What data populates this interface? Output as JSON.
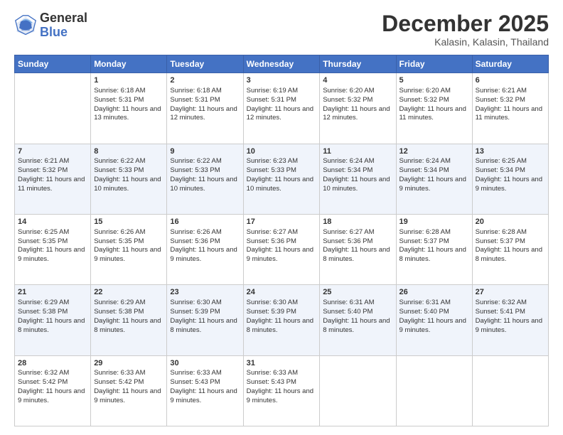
{
  "header": {
    "logo_general": "General",
    "logo_blue": "Blue",
    "month_title": "December 2025",
    "location": "Kalasin, Kalasin, Thailand"
  },
  "days_of_week": [
    "Sunday",
    "Monday",
    "Tuesday",
    "Wednesday",
    "Thursday",
    "Friday",
    "Saturday"
  ],
  "weeks": [
    [
      {
        "day": "",
        "sunrise": "",
        "sunset": "",
        "daylight": ""
      },
      {
        "day": "1",
        "sunrise": "Sunrise: 6:18 AM",
        "sunset": "Sunset: 5:31 PM",
        "daylight": "Daylight: 11 hours and 13 minutes."
      },
      {
        "day": "2",
        "sunrise": "Sunrise: 6:18 AM",
        "sunset": "Sunset: 5:31 PM",
        "daylight": "Daylight: 11 hours and 12 minutes."
      },
      {
        "day": "3",
        "sunrise": "Sunrise: 6:19 AM",
        "sunset": "Sunset: 5:31 PM",
        "daylight": "Daylight: 11 hours and 12 minutes."
      },
      {
        "day": "4",
        "sunrise": "Sunrise: 6:20 AM",
        "sunset": "Sunset: 5:32 PM",
        "daylight": "Daylight: 11 hours and 12 minutes."
      },
      {
        "day": "5",
        "sunrise": "Sunrise: 6:20 AM",
        "sunset": "Sunset: 5:32 PM",
        "daylight": "Daylight: 11 hours and 11 minutes."
      },
      {
        "day": "6",
        "sunrise": "Sunrise: 6:21 AM",
        "sunset": "Sunset: 5:32 PM",
        "daylight": "Daylight: 11 hours and 11 minutes."
      }
    ],
    [
      {
        "day": "7",
        "sunrise": "Sunrise: 6:21 AM",
        "sunset": "Sunset: 5:32 PM",
        "daylight": "Daylight: 11 hours and 11 minutes."
      },
      {
        "day": "8",
        "sunrise": "Sunrise: 6:22 AM",
        "sunset": "Sunset: 5:33 PM",
        "daylight": "Daylight: 11 hours and 10 minutes."
      },
      {
        "day": "9",
        "sunrise": "Sunrise: 6:22 AM",
        "sunset": "Sunset: 5:33 PM",
        "daylight": "Daylight: 11 hours and 10 minutes."
      },
      {
        "day": "10",
        "sunrise": "Sunrise: 6:23 AM",
        "sunset": "Sunset: 5:33 PM",
        "daylight": "Daylight: 11 hours and 10 minutes."
      },
      {
        "day": "11",
        "sunrise": "Sunrise: 6:24 AM",
        "sunset": "Sunset: 5:34 PM",
        "daylight": "Daylight: 11 hours and 10 minutes."
      },
      {
        "day": "12",
        "sunrise": "Sunrise: 6:24 AM",
        "sunset": "Sunset: 5:34 PM",
        "daylight": "Daylight: 11 hours and 9 minutes."
      },
      {
        "day": "13",
        "sunrise": "Sunrise: 6:25 AM",
        "sunset": "Sunset: 5:34 PM",
        "daylight": "Daylight: 11 hours and 9 minutes."
      }
    ],
    [
      {
        "day": "14",
        "sunrise": "Sunrise: 6:25 AM",
        "sunset": "Sunset: 5:35 PM",
        "daylight": "Daylight: 11 hours and 9 minutes."
      },
      {
        "day": "15",
        "sunrise": "Sunrise: 6:26 AM",
        "sunset": "Sunset: 5:35 PM",
        "daylight": "Daylight: 11 hours and 9 minutes."
      },
      {
        "day": "16",
        "sunrise": "Sunrise: 6:26 AM",
        "sunset": "Sunset: 5:36 PM",
        "daylight": "Daylight: 11 hours and 9 minutes."
      },
      {
        "day": "17",
        "sunrise": "Sunrise: 6:27 AM",
        "sunset": "Sunset: 5:36 PM",
        "daylight": "Daylight: 11 hours and 9 minutes."
      },
      {
        "day": "18",
        "sunrise": "Sunrise: 6:27 AM",
        "sunset": "Sunset: 5:36 PM",
        "daylight": "Daylight: 11 hours and 8 minutes."
      },
      {
        "day": "19",
        "sunrise": "Sunrise: 6:28 AM",
        "sunset": "Sunset: 5:37 PM",
        "daylight": "Daylight: 11 hours and 8 minutes."
      },
      {
        "day": "20",
        "sunrise": "Sunrise: 6:28 AM",
        "sunset": "Sunset: 5:37 PM",
        "daylight": "Daylight: 11 hours and 8 minutes."
      }
    ],
    [
      {
        "day": "21",
        "sunrise": "Sunrise: 6:29 AM",
        "sunset": "Sunset: 5:38 PM",
        "daylight": "Daylight: 11 hours and 8 minutes."
      },
      {
        "day": "22",
        "sunrise": "Sunrise: 6:29 AM",
        "sunset": "Sunset: 5:38 PM",
        "daylight": "Daylight: 11 hours and 8 minutes."
      },
      {
        "day": "23",
        "sunrise": "Sunrise: 6:30 AM",
        "sunset": "Sunset: 5:39 PM",
        "daylight": "Daylight: 11 hours and 8 minutes."
      },
      {
        "day": "24",
        "sunrise": "Sunrise: 6:30 AM",
        "sunset": "Sunset: 5:39 PM",
        "daylight": "Daylight: 11 hours and 8 minutes."
      },
      {
        "day": "25",
        "sunrise": "Sunrise: 6:31 AM",
        "sunset": "Sunset: 5:40 PM",
        "daylight": "Daylight: 11 hours and 8 minutes."
      },
      {
        "day": "26",
        "sunrise": "Sunrise: 6:31 AM",
        "sunset": "Sunset: 5:40 PM",
        "daylight": "Daylight: 11 hours and 9 minutes."
      },
      {
        "day": "27",
        "sunrise": "Sunrise: 6:32 AM",
        "sunset": "Sunset: 5:41 PM",
        "daylight": "Daylight: 11 hours and 9 minutes."
      }
    ],
    [
      {
        "day": "28",
        "sunrise": "Sunrise: 6:32 AM",
        "sunset": "Sunset: 5:42 PM",
        "daylight": "Daylight: 11 hours and 9 minutes."
      },
      {
        "day": "29",
        "sunrise": "Sunrise: 6:33 AM",
        "sunset": "Sunset: 5:42 PM",
        "daylight": "Daylight: 11 hours and 9 minutes."
      },
      {
        "day": "30",
        "sunrise": "Sunrise: 6:33 AM",
        "sunset": "Sunset: 5:43 PM",
        "daylight": "Daylight: 11 hours and 9 minutes."
      },
      {
        "day": "31",
        "sunrise": "Sunrise: 6:33 AM",
        "sunset": "Sunset: 5:43 PM",
        "daylight": "Daylight: 11 hours and 9 minutes."
      },
      {
        "day": "",
        "sunrise": "",
        "sunset": "",
        "daylight": ""
      },
      {
        "day": "",
        "sunrise": "",
        "sunset": "",
        "daylight": ""
      },
      {
        "day": "",
        "sunrise": "",
        "sunset": "",
        "daylight": ""
      }
    ]
  ]
}
